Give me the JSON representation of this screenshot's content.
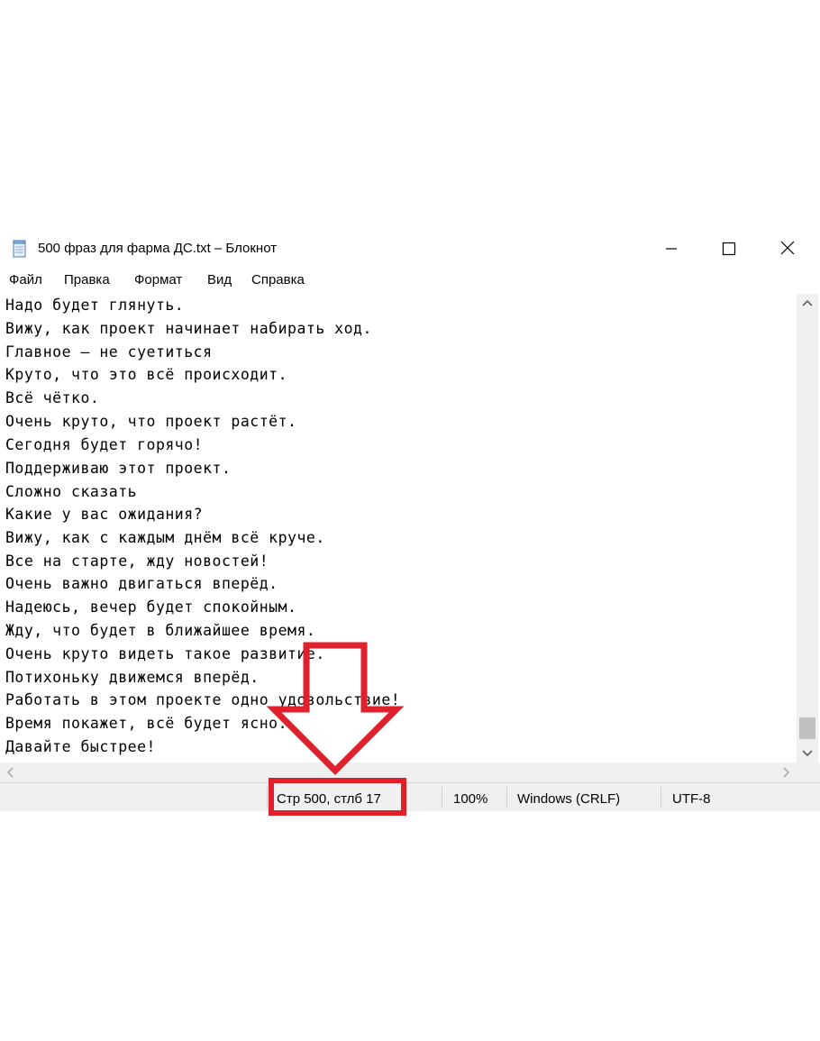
{
  "window": {
    "title": "500 фраз для фарма ДС.txt – Блокнот",
    "icon": "notepad-icon"
  },
  "titlebar_buttons": {
    "minimize": "minimize-icon",
    "maximize": "maximize-icon",
    "close": "close-icon"
  },
  "menu": {
    "items": [
      {
        "label": "Файл"
      },
      {
        "label": "Правка"
      },
      {
        "label": "Формат"
      },
      {
        "label": "Вид"
      },
      {
        "label": "Справка"
      }
    ]
  },
  "editor": {
    "lines": [
      "Надо будет глянуть.",
      "Вижу, как проект начинает набирать ход.",
      "Главное – не суетиться",
      "Круто, что это всё происходит.",
      "Всё чётко.",
      "Очень круто, что проект растёт.",
      "Сегодня будет горячо!",
      "Поддерживаю этот проект.",
      "Сложно сказать",
      "Какие у вас ожидания?",
      "Вижу, как с каждым днём всё круче.",
      "Все на старте, жду новостей!",
      "Очень важно двигаться вперёд.",
      "Надеюсь, вечер будет спокойным.",
      "Жду, что будет в ближайшее время.",
      "Очень круто видеть такое развитие.",
      "Потихоньку движемся вперёд.",
      "Работать в этом проекте одно удовольствие!",
      "Время покажет, всё будет ясно.",
      "Давайте быстрее!"
    ]
  },
  "statusbar": {
    "position": "Стр 500, стлб 17",
    "zoom": "100%",
    "line_endings": "Windows (CRLF)",
    "encoding": "UTF-8"
  },
  "annotation": {
    "color": "#e0202a"
  }
}
